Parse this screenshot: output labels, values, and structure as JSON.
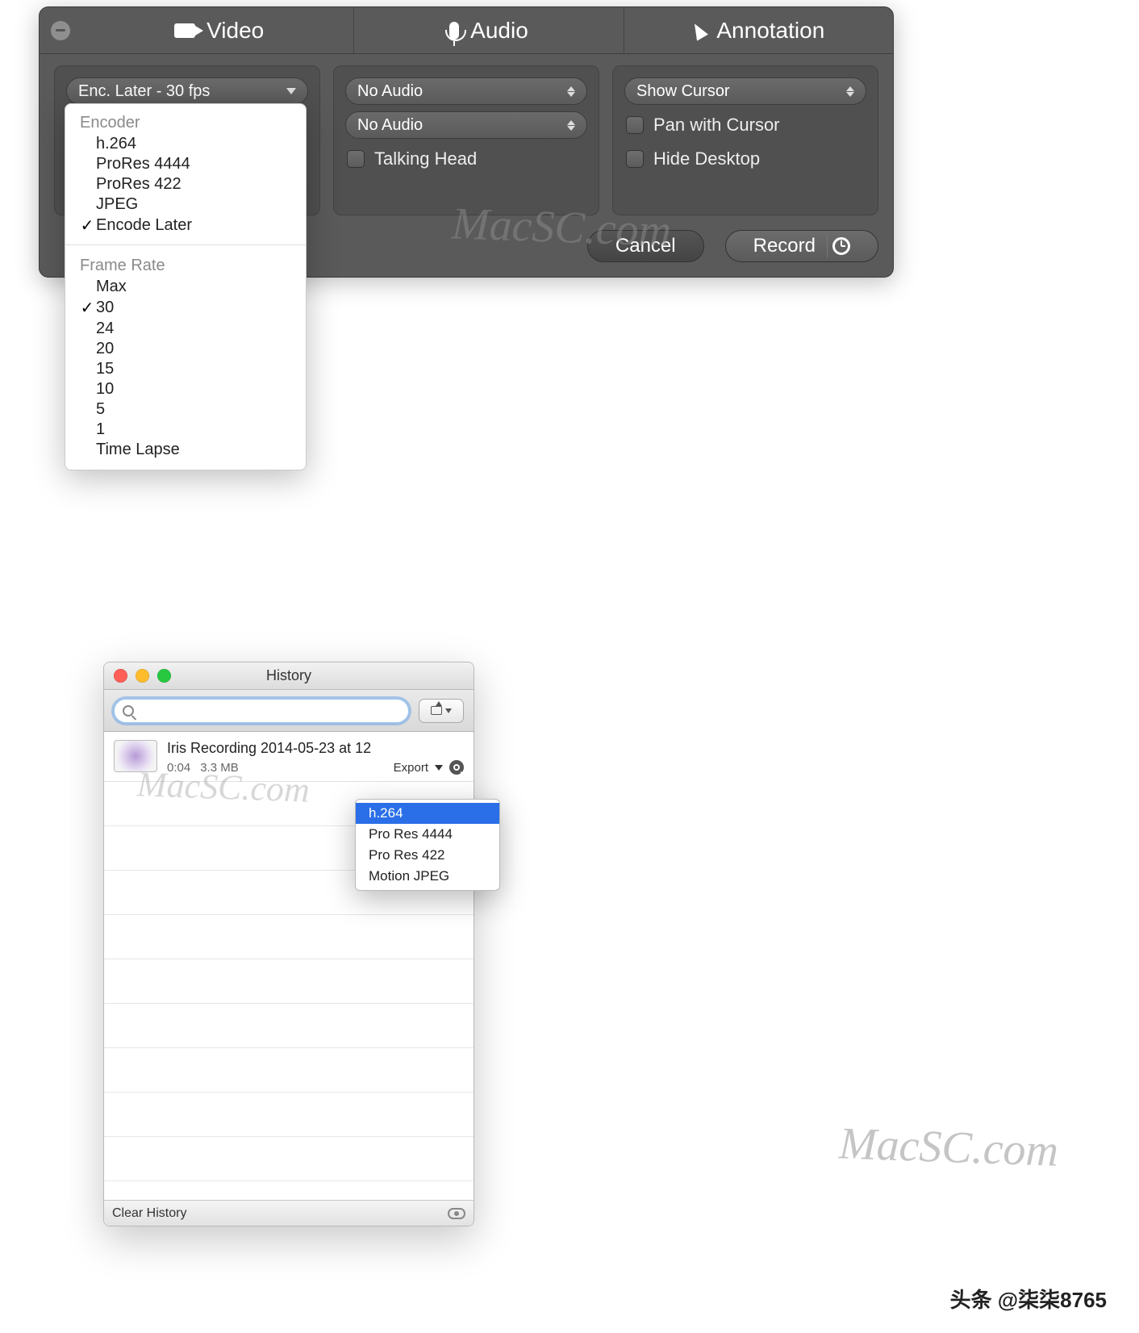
{
  "panel": {
    "tabs": {
      "video": "Video",
      "audio": "Audio",
      "annotation": "Annotation"
    },
    "video_col": {
      "encoder_dd": "Enc. Later - 30 fps"
    },
    "audio_col": {
      "dd1": "No Audio",
      "dd2": "No Audio",
      "talking_head": "Talking Head"
    },
    "anno_col": {
      "cursor_dd": "Show Cursor",
      "pan": "Pan with Cursor",
      "hide": "Hide Desktop"
    },
    "footer": {
      "cancel": "Cancel",
      "record": "Record"
    }
  },
  "encoder_menu": {
    "hdr1": "Encoder",
    "items1": [
      "h.264",
      "ProRes 4444",
      "ProRes 422",
      "JPEG",
      "Encode Later"
    ],
    "checked1": 4,
    "hdr2": "Frame Rate",
    "items2": [
      "Max",
      "30",
      "24",
      "20",
      "15",
      "10",
      "5",
      "1",
      "Time Lapse"
    ],
    "checked2": 1
  },
  "history": {
    "title": "History",
    "item": {
      "name": "Iris Recording 2014-05-23 at 12",
      "duration": "0:04",
      "size": "3.3 MB",
      "export_label": "Export"
    },
    "clear": "Clear History"
  },
  "export_menu": {
    "items": [
      "h.264",
      "Pro Res 4444",
      "Pro Res 422",
      "Motion JPEG"
    ],
    "selected": 0
  },
  "watermark": "MacSC.com",
  "credit": "头条 @柒柒8765"
}
